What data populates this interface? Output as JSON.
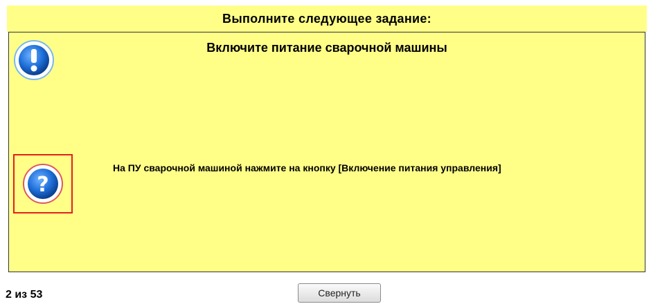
{
  "header": {
    "title": "Выполните следующее задание:"
  },
  "task": {
    "title": "Включите питание сварочной машины",
    "hint": "На ПУ сварочной машиной нажмите на кнопку [Включение питания управления]"
  },
  "icons": {
    "info": "info-icon",
    "help": "help-icon"
  },
  "footer": {
    "progress": "2 из 53",
    "collapse_label": "Свернуть"
  },
  "colors": {
    "background": "#ffff88",
    "hint_border": "#e02020",
    "icon_blue": "#1e6fd9"
  }
}
